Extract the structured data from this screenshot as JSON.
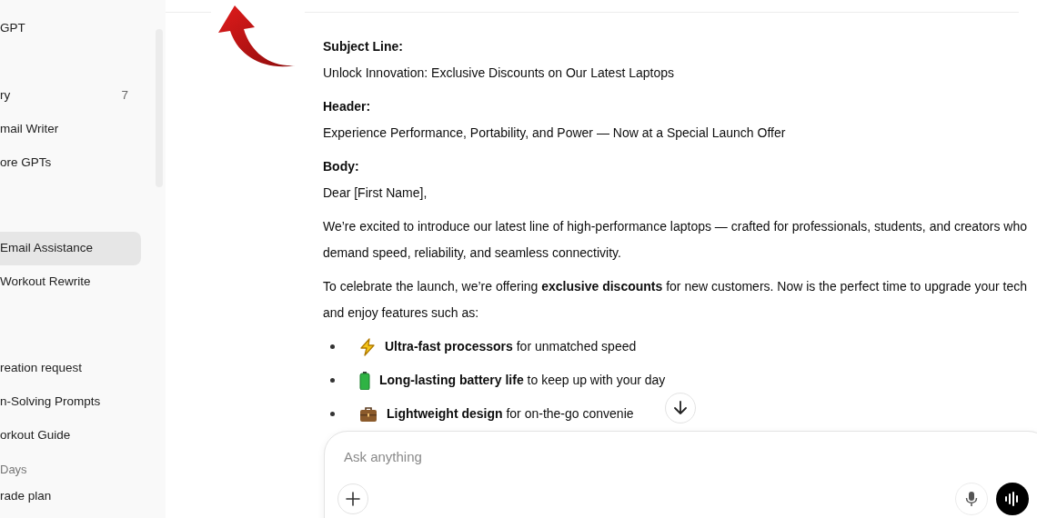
{
  "sidebar": {
    "groups": [
      {
        "items": [
          {
            "label": "GPT",
            "selected": false
          }
        ]
      },
      {
        "items": [
          {
            "label": "ry",
            "count": "7",
            "selected": false
          },
          {
            "label": "mail Writer",
            "selected": false
          },
          {
            "label": "ore GPTs",
            "selected": false
          }
        ]
      },
      {
        "items": [
          {
            "label": "Email Assistance",
            "selected": true
          },
          {
            "label": "Workout Rewrite",
            "selected": false
          }
        ]
      },
      {
        "items": [
          {
            "label": "reation request",
            "selected": false
          },
          {
            "label": "n-Solving Prompts",
            "selected": false
          },
          {
            "label": "orkout Guide",
            "selected": false
          }
        ]
      },
      {
        "heading": "Days",
        "items": [
          {
            "label": "rade plan",
            "selected": false
          }
        ]
      }
    ]
  },
  "message": {
    "blocks": [
      {
        "kind": "label",
        "text": "Subject Line:"
      },
      {
        "kind": "text",
        "text": "Unlock Innovation: Exclusive Discounts on Our Latest Laptops"
      },
      {
        "kind": "label",
        "text": "Header:"
      },
      {
        "kind": "text",
        "text": "Experience Performance, Portability, and Power — Now at a Special Launch Offer"
      },
      {
        "kind": "label",
        "text": "Body:"
      },
      {
        "kind": "text",
        "text": "Dear [First Name],"
      },
      {
        "kind": "para",
        "text": "We’re excited to introduce our latest line of high-performance laptops — crafted for professionals, students, and creators who demand speed, reliability, and seamless connectivity."
      },
      {
        "kind": "para",
        "text": "To celebrate the launch, we’re offering **exclusive discounts** for new customers. Now is the perfect time to upgrade your tech and enjoy features such as:"
      },
      {
        "kind": "bullet",
        "text": "**Ultra-fast processors** for unmatched speed"
      },
      {
        "kind": "bullet",
        "text": "**Long-lasting battery life** to keep up with your day"
      },
      {
        "kind": "bullet",
        "text": "**Lightweight design** for on-the-go convenie"
      }
    ]
  },
  "composer": {
    "placeholder": "Ask anything"
  }
}
